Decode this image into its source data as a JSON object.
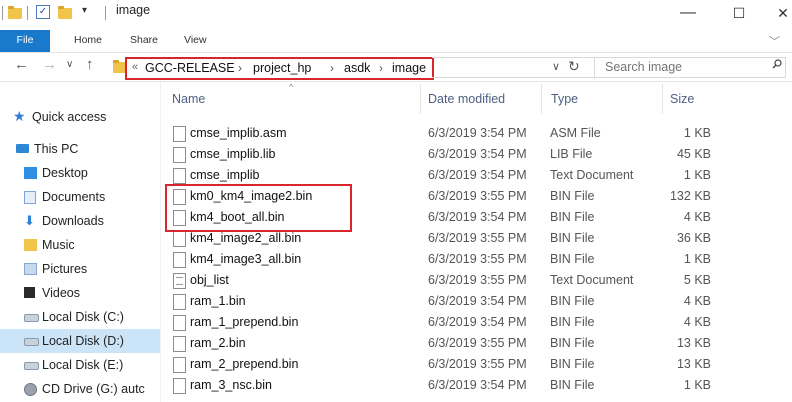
{
  "window": {
    "title": "image",
    "minimize": "—",
    "maximize": "☐",
    "close": "✕"
  },
  "ribbon": {
    "tabs": [
      "File",
      "Home",
      "Share",
      "View"
    ],
    "expand": "﹀"
  },
  "address": {
    "overflow": "«",
    "crumbs": [
      "GCC-RELEASE",
      "project_hp",
      "asdk",
      "image"
    ],
    "separator": "›",
    "dropdown": "∨",
    "refresh": "↻"
  },
  "search": {
    "placeholder": "Search image",
    "icon": "search-icon"
  },
  "nav": {
    "quick_access": "Quick access",
    "items": [
      {
        "label": "This PC",
        "icon": "computer-icon"
      },
      {
        "label": "Desktop",
        "icon": "desktop-icon"
      },
      {
        "label": "Documents",
        "icon": "documents-icon"
      },
      {
        "label": "Downloads",
        "icon": "downloads-icon"
      },
      {
        "label": "Music",
        "icon": "music-icon"
      },
      {
        "label": "Pictures",
        "icon": "pictures-icon"
      },
      {
        "label": "Videos",
        "icon": "videos-icon"
      },
      {
        "label": "Local Disk (C:)",
        "icon": "disk-icon"
      },
      {
        "label": "Local Disk (D:)",
        "icon": "disk-icon",
        "selected": true
      },
      {
        "label": "Local Disk (E:)",
        "icon": "disk-icon"
      },
      {
        "label": "CD Drive (G:) autc",
        "icon": "cd-icon"
      }
    ]
  },
  "columns": {
    "name": "Name",
    "date": "Date modified",
    "type": "Type",
    "size": "Size"
  },
  "files": [
    {
      "name": "cmse_implib.asm",
      "date": "6/3/2019 3:54 PM",
      "type": "ASM File",
      "size": "1 KB"
    },
    {
      "name": "cmse_implib.lib",
      "date": "6/3/2019 3:54 PM",
      "type": "LIB File",
      "size": "45 KB"
    },
    {
      "name": "cmse_implib",
      "date": "6/3/2019 3:54 PM",
      "type": "Text Document",
      "size": "1 KB"
    },
    {
      "name": "km0_km4_image2.bin",
      "date": "6/3/2019 3:55 PM",
      "type": "BIN File",
      "size": "132 KB"
    },
    {
      "name": "km4_boot_all.bin",
      "date": "6/3/2019 3:54 PM",
      "type": "BIN File",
      "size": "4 KB"
    },
    {
      "name": "km4_image2_all.bin",
      "date": "6/3/2019 3:55 PM",
      "type": "BIN File",
      "size": "36 KB"
    },
    {
      "name": "km4_image3_all.bin",
      "date": "6/3/2019 3:55 PM",
      "type": "BIN File",
      "size": "1 KB"
    },
    {
      "name": "obj_list",
      "date": "6/3/2019 3:55 PM",
      "type": "Text Document",
      "size": "5 KB"
    },
    {
      "name": "ram_1.bin",
      "date": "6/3/2019 3:54 PM",
      "type": "BIN File",
      "size": "4 KB"
    },
    {
      "name": "ram_1_prepend.bin",
      "date": "6/3/2019 3:54 PM",
      "type": "BIN File",
      "size": "4 KB"
    },
    {
      "name": "ram_2.bin",
      "date": "6/3/2019 3:55 PM",
      "type": "BIN File",
      "size": "13 KB"
    },
    {
      "name": "ram_2_prepend.bin",
      "date": "6/3/2019 3:55 PM",
      "type": "BIN File",
      "size": "13 KB"
    },
    {
      "name": "ram_3_nsc.bin",
      "date": "6/3/2019 3:54 PM",
      "type": "BIN File",
      "size": "1 KB"
    }
  ],
  "colors": {
    "highlight_border": "#d8262c",
    "file_tab": "#1979ca",
    "selection": "#cce4f7"
  }
}
